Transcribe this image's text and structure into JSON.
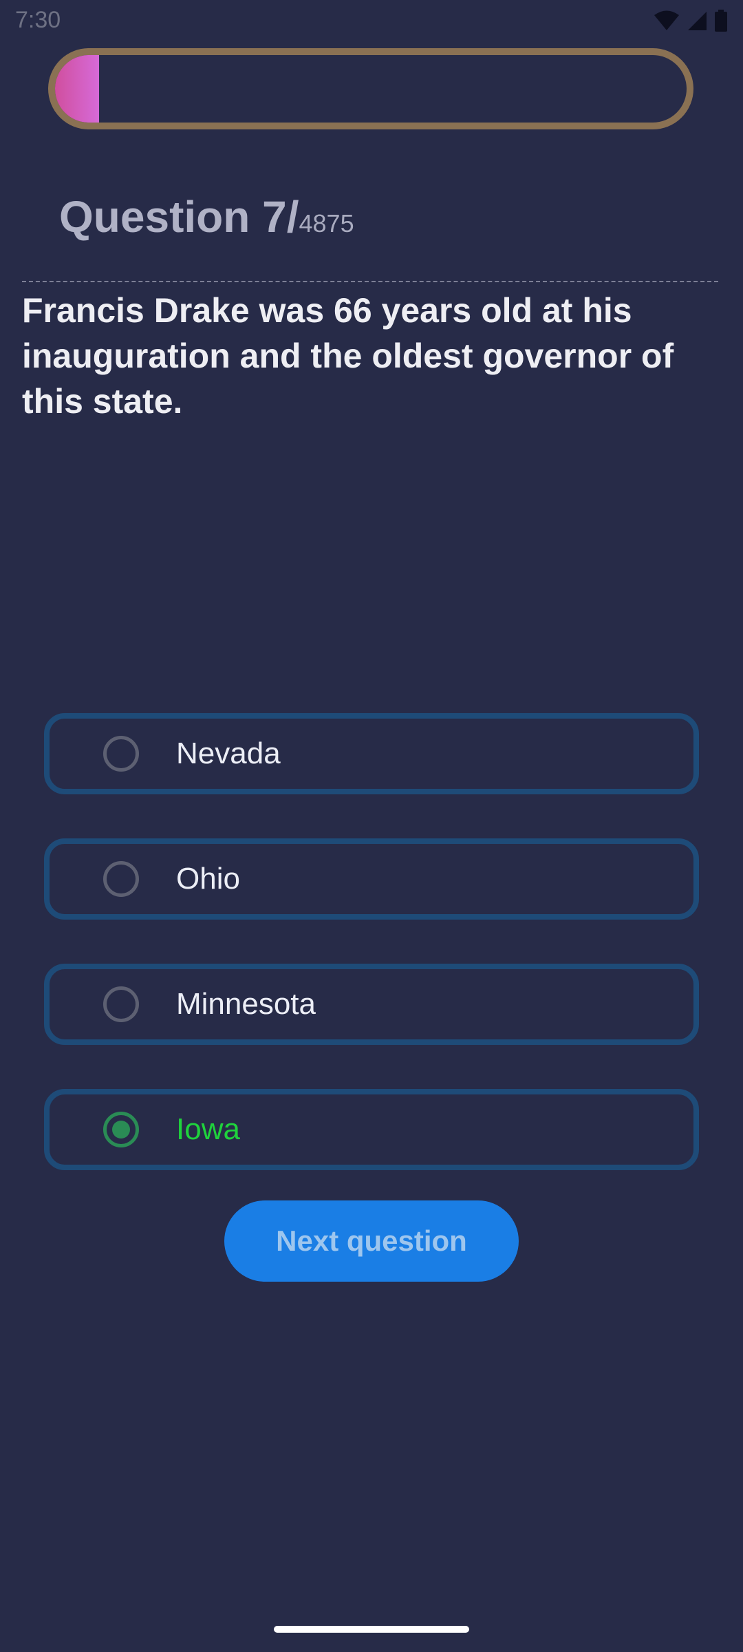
{
  "status_bar": {
    "time": "7:30",
    "icons": [
      "wifi-icon",
      "signal-icon",
      "battery-icon"
    ]
  },
  "progress": {
    "fraction": 0.07,
    "fill_color": "#d66ad8",
    "track_border_color": "#8a7153"
  },
  "counter": {
    "current": "Question 7/",
    "total": "4875"
  },
  "question": {
    "text": "Francis Drake was 66 years old at his inauguration and the oldest governor of this state."
  },
  "options": [
    {
      "label": "Nevada",
      "selected": false
    },
    {
      "label": "Ohio",
      "selected": false
    },
    {
      "label": "Minnesota",
      "selected": false
    },
    {
      "label": "Iowa",
      "selected": true
    }
  ],
  "next_button": {
    "label": "Next question"
  },
  "colors": {
    "background": "#272b48",
    "option_border": "#1e4b78",
    "selected_text": "#1fd23c",
    "button": "#1a7ee5"
  }
}
